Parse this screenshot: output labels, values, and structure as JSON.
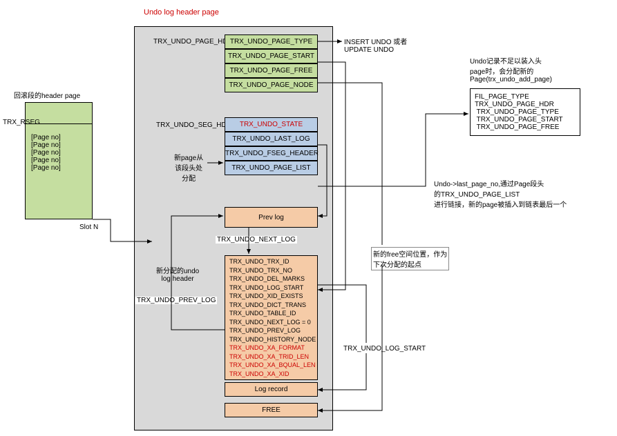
{
  "title": "Undo log header page",
  "left": {
    "caption": "回滚段的header page",
    "rseg": "TRX_RSEG",
    "pages": [
      "[Page no]",
      "[Page no]",
      "[Page no]",
      "[Page no]",
      "[Page no]"
    ],
    "slot": "Slot N"
  },
  "page_hdr": {
    "label": "TRX_UNDO_PAGE_HDR",
    "fields": [
      "TRX_UNDO_PAGE_TYPE",
      "TRX_UNDO_PAGE_START",
      "TRX_UNDO_PAGE_FREE",
      "TRX_UNDO_PAGE_NODE"
    ]
  },
  "seg_hdr": {
    "label": "TRX_UNDO_SEG_HDR",
    "fields": [
      "TRX_UNDO_STATE",
      "TRX_UNDO_LAST_LOG",
      "TRX_UNDO_FSEG_HEADER",
      "TRX_UNDO_PAGE_LIST"
    ],
    "note": "新page从\n该段头处\n分配"
  },
  "prev_log": "Prev log",
  "next_log_label": "TRX_UNDO_NEXT_LOG",
  "prev_log_label": "TRX_UNDO_PREV_LOG",
  "log_hdr": {
    "caption": "新分配的undo\nlog header",
    "fields": [
      "TRX_UNDO_TRX_ID",
      "TRX_UNDO_TRX_NO",
      "TRX_UNDO_DEL_MARKS",
      "TRX_UNDO_LOG_START",
      "TRX_UNDO_XID_EXISTS",
      "TRX_UNDO_DICT_TRANS",
      "TRX_UNDO_TABLE_ID",
      "TRX_UNDO_NEXT_LOG = 0",
      "TRX_UNDO_PREV_LOG",
      "TRX_UNDO_HISTORY_NODE",
      "TRX_UNDO_XA_FORMAT",
      "TRX_UNDO_XA_TRID_LEN",
      "TRX_UNDO_XA_BQUAL_LEN",
      "TRX_UNDO_XA_XID"
    ],
    "record": "Log record",
    "free": "FREE"
  },
  "right": {
    "insert_update": "INSERT UNDO 或者\nUPDATE UNDO",
    "add_page_caption": "Undo记录不足以装入头\npage时，会分配新的\nPage(trx_undo_add_page)",
    "add_page_fields": [
      "FIL_PAGE_TYPE",
      "TRX_UNDO_PAGE_HDR",
      " TRX_UNDO_PAGE_TYPE",
      " TRX_UNDO_PAGE_START",
      " TRX_UNDO_PAGE_FREE"
    ],
    "link_note": "Undo->last_page_no,通过Page段头\n的TRX_UNDO_PAGE_LIST\n进行链接，新的page被插入到链表最后一个",
    "free_note": "新的free空间位置，作为\n下次分配的起点",
    "log_start_label": "TRX_UNDO_LOG_START"
  }
}
